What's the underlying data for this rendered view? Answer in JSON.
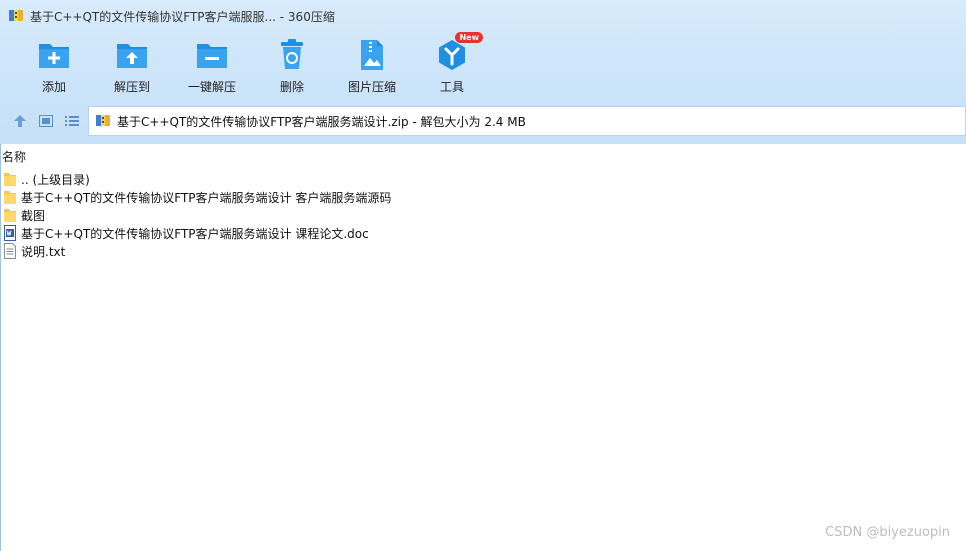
{
  "window": {
    "title": "基于C++QT的文件传输协议FTP客户端服服... - 360压缩"
  },
  "toolbar": {
    "buttons": [
      {
        "label": "添加",
        "icon": "add-folder-icon"
      },
      {
        "label": "解压到",
        "icon": "extract-to-icon"
      },
      {
        "label": "一键解压",
        "icon": "one-click-extract-icon"
      },
      {
        "label": "删除",
        "icon": "recycle-bin-icon"
      },
      {
        "label": "图片压缩",
        "icon": "image-compress-icon"
      },
      {
        "label": "工具",
        "icon": "tools-icon",
        "badge": "New"
      }
    ]
  },
  "address": {
    "path": "基于C++QT的文件传输协议FTP客户端服务端设计.zip - 解包大小为 2.4 MB"
  },
  "list": {
    "column_name": "名称",
    "items": [
      {
        "name": ".. (上级目录)",
        "type": "folder"
      },
      {
        "name": "基于C++QT的文件传输协议FTP客户端服务端设计 客户端服务端源码",
        "type": "folder"
      },
      {
        "name": "截图",
        "type": "folder"
      },
      {
        "name": "基于C++QT的文件传输协议FTP客户端服务端设计 课程论文.doc",
        "type": "doc"
      },
      {
        "name": "说明.txt",
        "type": "txt"
      }
    ]
  },
  "watermark": "CSDN @biyezuopin",
  "colors": {
    "accent": "#1e8fe1",
    "toolbar_bg": "#cfe6fa",
    "badge": "#e6332f"
  }
}
